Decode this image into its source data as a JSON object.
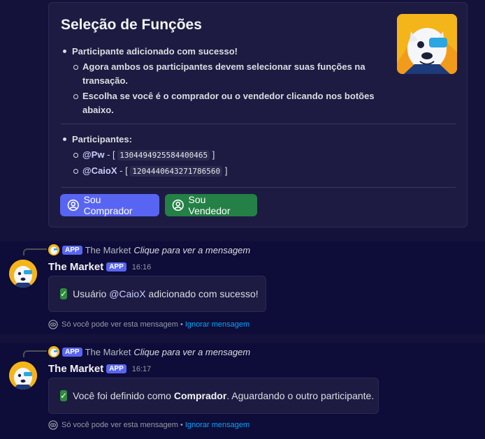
{
  "embed": {
    "title": "Seleção de Funções",
    "bullet1": "Participante adicionado com sucesso!",
    "sub1": "Agora ambos os participantes devem selecionar suas funções na",
    "sub1b": "transação.",
    "sub2": "Escolha se você é o comprador ou o vendedor clicando nos botões",
    "sub2b": "abaixo.",
    "participants_label": "Participantes:",
    "p1_mention": "@Pw",
    "p1_id": "1304494925584400465",
    "p2_mention": "@CaioX",
    "p2_id": "1204440643271786560",
    "dash": "- [",
    "close": "]",
    "buyer_button": "Sou Comprador",
    "seller_button": "Sou Vendedor"
  },
  "msg1": {
    "reply_tag": "APP",
    "reply_name": "The Market",
    "reply_text": "Clique para ver a mensagem",
    "author": "The Market",
    "tag": "APP",
    "time": "16:16",
    "text_pre": "Usuário ",
    "mention": "@CaioX",
    "text_post": " adicionado com sucesso!",
    "eph_text": "Só você pode ver esta mensagem •",
    "eph_link": "Ignorar mensagem"
  },
  "msg2": {
    "reply_tag": "APP",
    "reply_name": "The Market",
    "reply_text": "Clique para ver a mensagem",
    "author": "The Market",
    "tag": "APP",
    "time": "16:17",
    "text_pre": "Você foi definido como ",
    "bold": "Comprador",
    "text_post": ". Aguardando o outro participante.",
    "eph_text": "Só você pode ver esta mensagem •",
    "eph_link": "Ignorar mensagem"
  },
  "colors": {
    "blurple": "#5865f2",
    "green": "#248046",
    "link": "#00a8fc",
    "background": "#14123a"
  }
}
